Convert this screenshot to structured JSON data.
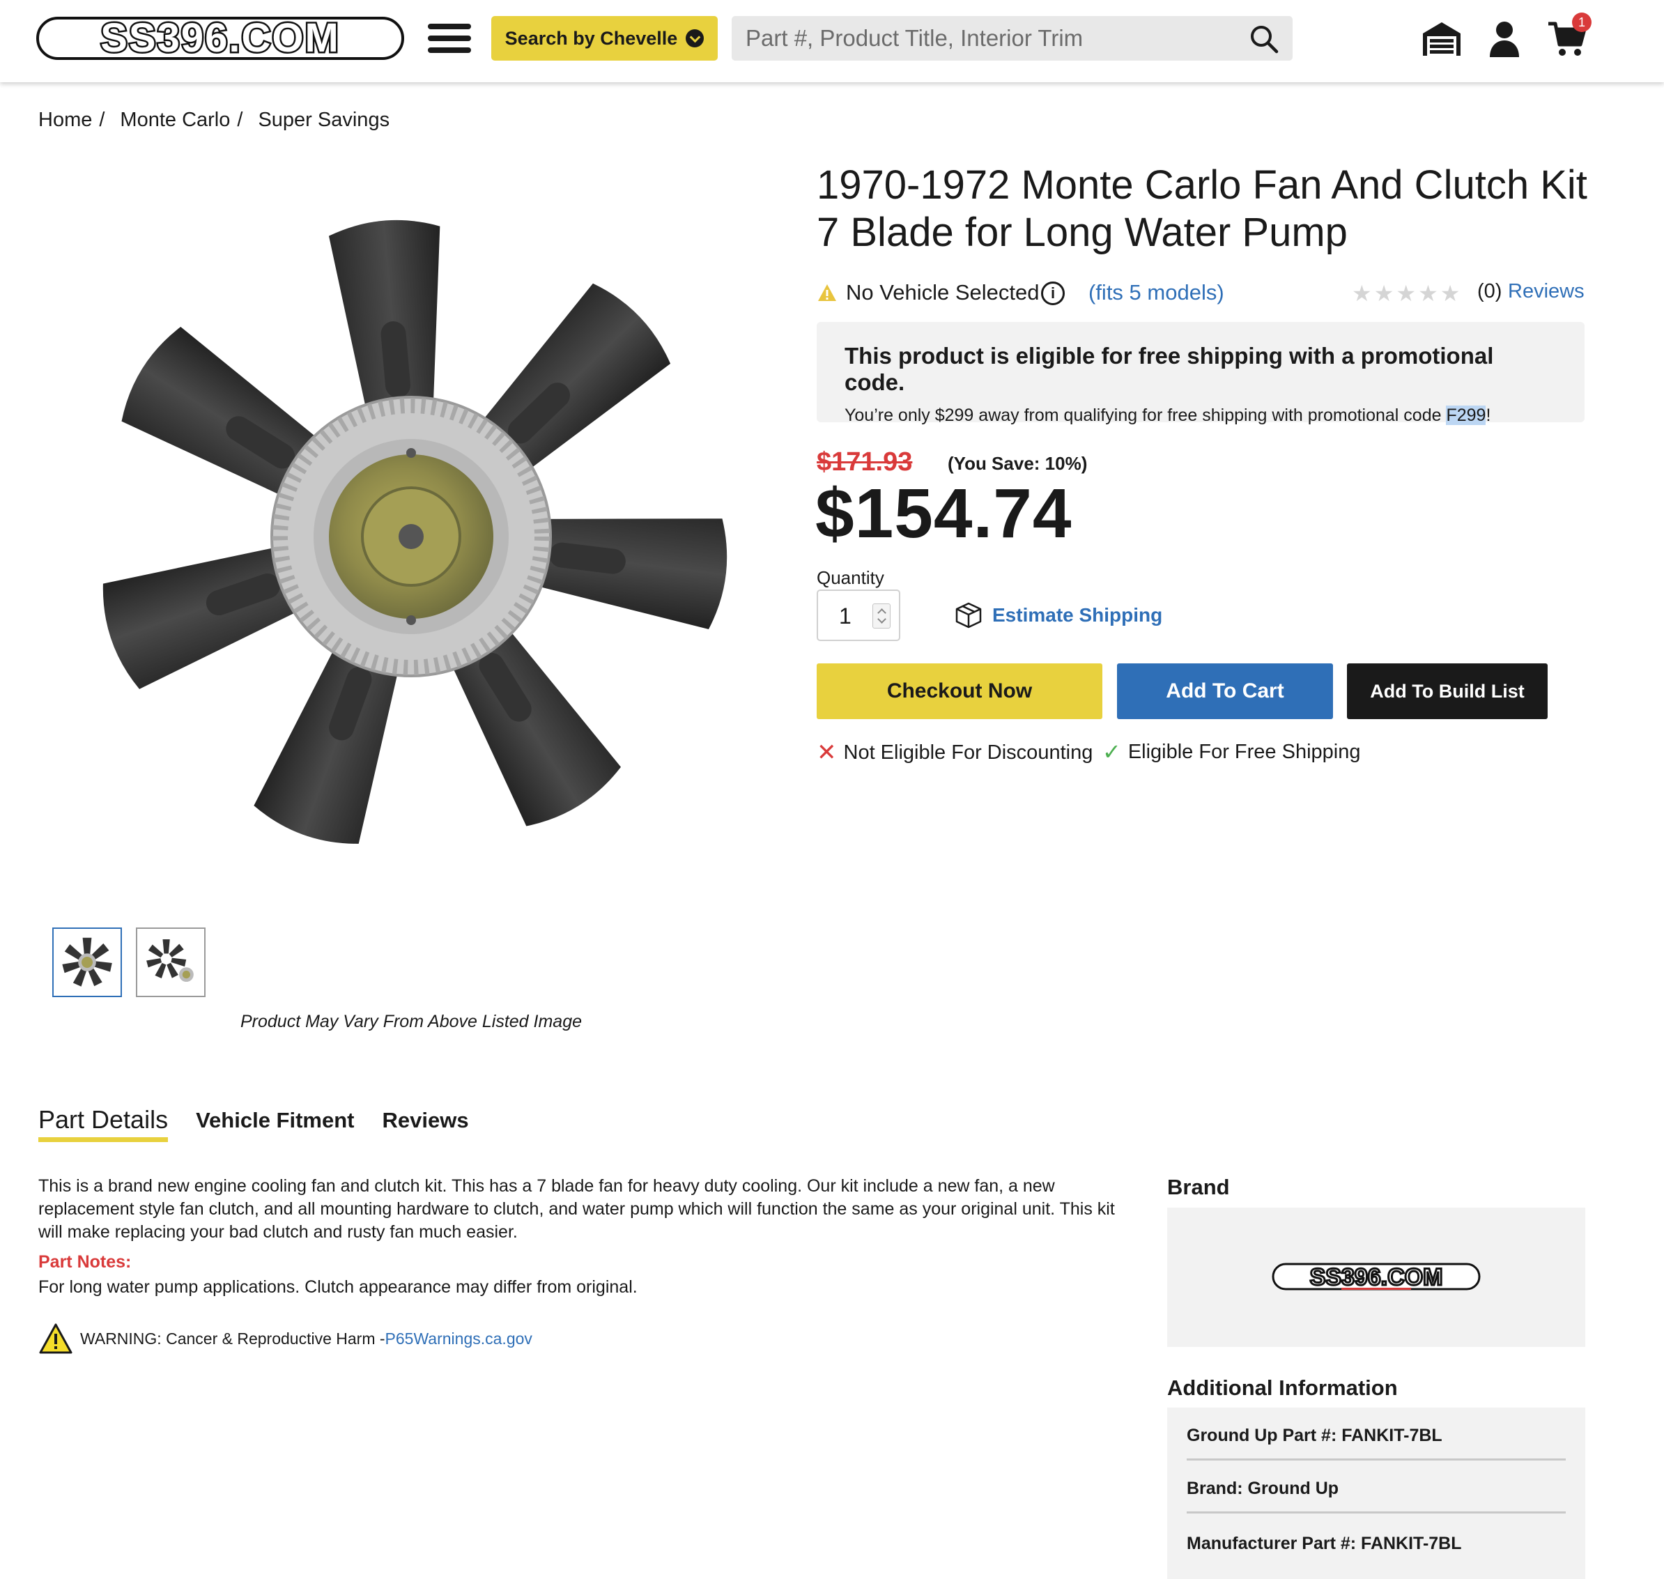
{
  "header": {
    "logo_text": "SS396.COM",
    "search_by_label": "Search by Chevelle",
    "search_placeholder": "Part #, Product Title, Interior Trim",
    "cart_count": "1"
  },
  "breadcrumb": [
    "Home",
    "Monte Carlo",
    "Super Savings"
  ],
  "product": {
    "title": "1970-1972 Monte Carlo Fan And Clutch Kit 7 Blade for Long Water Pump",
    "vehicle_status": "No Vehicle Selected",
    "fits_models": "(fits 5 models)",
    "review_count": "(0)",
    "reviews_link": "Reviews",
    "rating_stars": 0,
    "image_note": "Product May Vary From Above Listed Image"
  },
  "promo": {
    "title": "This product is eligible for free shipping with a promotional code.",
    "text_before": "You’re only $299 away from qualifying for free shipping with promotional code ",
    "code": "F299",
    "text_after": "!"
  },
  "pricing": {
    "old_price": "$171.93",
    "you_save": "(You Save: 10%)",
    "price": "$154.74"
  },
  "purchase": {
    "quantity_label": "Quantity",
    "quantity_value": "1",
    "estimate_shipping": "Estimate Shipping",
    "checkout_label": "Checkout Now",
    "add_to_cart_label": "Add To Cart",
    "add_to_build_list_label": "Add To Build List",
    "not_eligible_discount": "Not Eligible For Discounting",
    "eligible_free_shipping": "Eligible For Free Shipping"
  },
  "tabs": [
    "Part Details",
    "Vehicle Fitment",
    "Reviews"
  ],
  "details": {
    "description": "This is a brand new engine cooling fan and clutch kit. This has a 7 blade fan for heavy duty cooling. Our kit include a new fan, a new replacement style fan clutch, and all mounting hardware to clutch, and water pump which will function the same as your original unit. This kit will make replacing your bad clutch and rusty fan much easier.",
    "notes_label": "Part Notes:",
    "notes_text": "For long water pump applications. Clutch appearance may differ from original.",
    "warning_text": "WARNING: Cancer & Reproductive Harm - ",
    "warning_link": "P65Warnings.ca.gov"
  },
  "sidebar": {
    "brand_label": "Brand",
    "additional_label": "Additional Information",
    "rows": [
      "Ground Up Part #: FANKIT-7BL",
      "Brand: Ground Up",
      "Manufacturer Part #: FANKIT-7BL"
    ]
  },
  "colors": {
    "accent_yellow": "#e8d13e",
    "link_blue": "#2f6fb7",
    "sale_red": "#d93a3a",
    "check_green": "#4caf50"
  },
  "icons": [
    "menu-icon",
    "chevron-down-icon",
    "search-icon",
    "garage-icon",
    "account-icon",
    "cart-icon",
    "warning-icon",
    "info-icon",
    "star-icon",
    "box-icon",
    "x-icon",
    "check-icon"
  ]
}
